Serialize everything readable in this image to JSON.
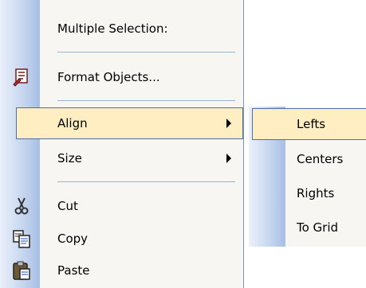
{
  "menu": {
    "header": "Multiple Selection:",
    "items": {
      "format_objects": {
        "label": "Format Objects...",
        "icon": "format-objects-icon"
      },
      "align": {
        "label": "Align"
      },
      "size": {
        "label": "Size"
      },
      "cut": {
        "label": "Cut",
        "icon": "scissors-icon"
      },
      "copy": {
        "label": "Copy",
        "icon": "copy-icon"
      },
      "paste": {
        "label": "Paste",
        "icon": "paste-icon"
      }
    }
  },
  "submenu": {
    "items": [
      "Lefts",
      "Centers",
      "Rights",
      "To Grid"
    ]
  },
  "colors": {
    "highlight_fill": "#ffeec2",
    "highlight_border": "#4b6fa6",
    "gutter": "#c8d7f0",
    "menu_background": "#f7f6f3"
  }
}
